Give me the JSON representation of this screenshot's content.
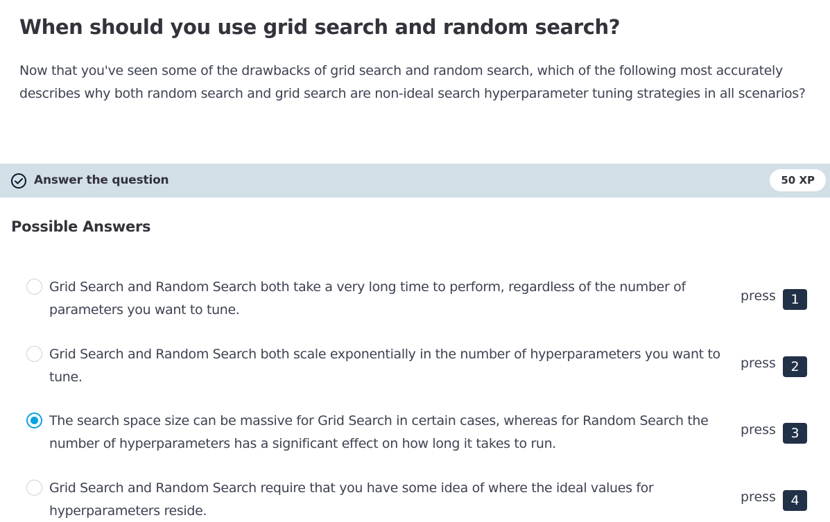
{
  "exercise": {
    "title": "When should you use grid search and random search?",
    "description": "Now that you've seen some of the drawbacks of grid search and random search, which of the following most accurately describes why both random search and grid search are non-ideal search hyperparameter tuning strategies in all scenarios?"
  },
  "task_bar": {
    "icon": "check-circle-icon",
    "label": "Answer the question",
    "xp": "50 XP"
  },
  "answers": {
    "heading": "Possible Answers",
    "press_label": "press",
    "selected_index": 2,
    "items": [
      {
        "text": "Grid Search and Random Search both take a very long time to perform, regardless of the number of parameters you want to tune.",
        "key": "1",
        "selected": false
      },
      {
        "text": "Grid Search and Random Search both scale exponentially in the number of hyperparameters you want to tune.",
        "key": "2",
        "selected": false
      },
      {
        "text": "The search space size can be massive for Grid Search in certain cases, whereas for Random Search the number of hyperparameters has a significant effect on how long it takes to run.",
        "key": "3",
        "selected": true
      },
      {
        "text": "Grid Search and Random Search require that you have some idea of where the ideal values for hyperparameters reside.",
        "key": "4",
        "selected": false
      }
    ]
  },
  "colors": {
    "task_bar_bg": "#d3dfe6",
    "radio_selected": "#05a3e0",
    "key_bg": "#213147"
  }
}
